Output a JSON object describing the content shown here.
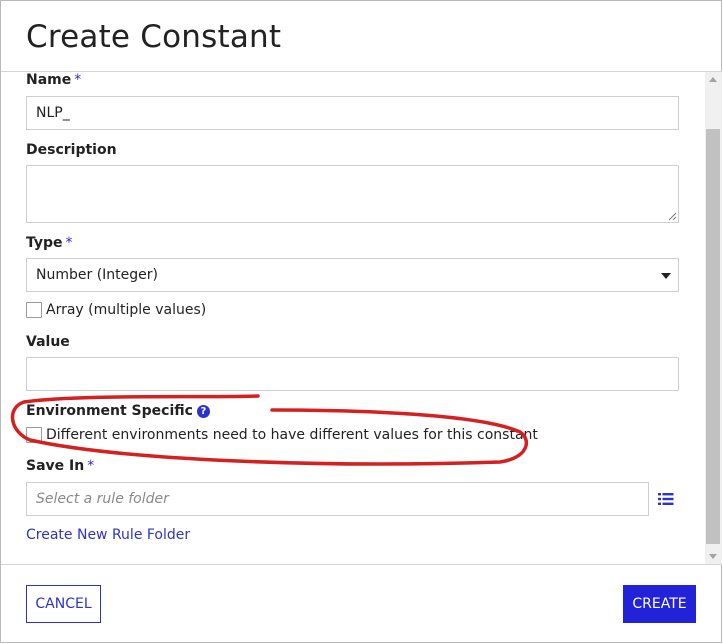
{
  "dialog": {
    "title": "Create Constant"
  },
  "form": {
    "name": {
      "label": "Name",
      "required_mark": "*",
      "value": "NLP_"
    },
    "description": {
      "label": "Description",
      "value": ""
    },
    "type": {
      "label": "Type",
      "required_mark": "*",
      "selected": "Number (Integer)"
    },
    "array_checkbox": {
      "label": "Array (multiple values)",
      "checked": false
    },
    "value": {
      "label": "Value",
      "value": ""
    },
    "environment": {
      "label": "Environment Specific",
      "help_icon_glyph": "?",
      "checkbox_label": "Different environments need to have different values for this constant",
      "checked": false
    },
    "save_in": {
      "label": "Save In",
      "required_mark": "*",
      "placeholder": "Select a rule folder"
    },
    "create_folder_link": "Create New Rule Folder"
  },
  "footer": {
    "cancel_label": "CANCEL",
    "create_label": "CREATE"
  },
  "colors": {
    "accent": "#2222d9",
    "link": "#2d33c9",
    "annotation": "#d42020"
  },
  "icons": [
    "help-icon",
    "list-icon",
    "chevron-down-icon",
    "resize-handle-icon"
  ]
}
